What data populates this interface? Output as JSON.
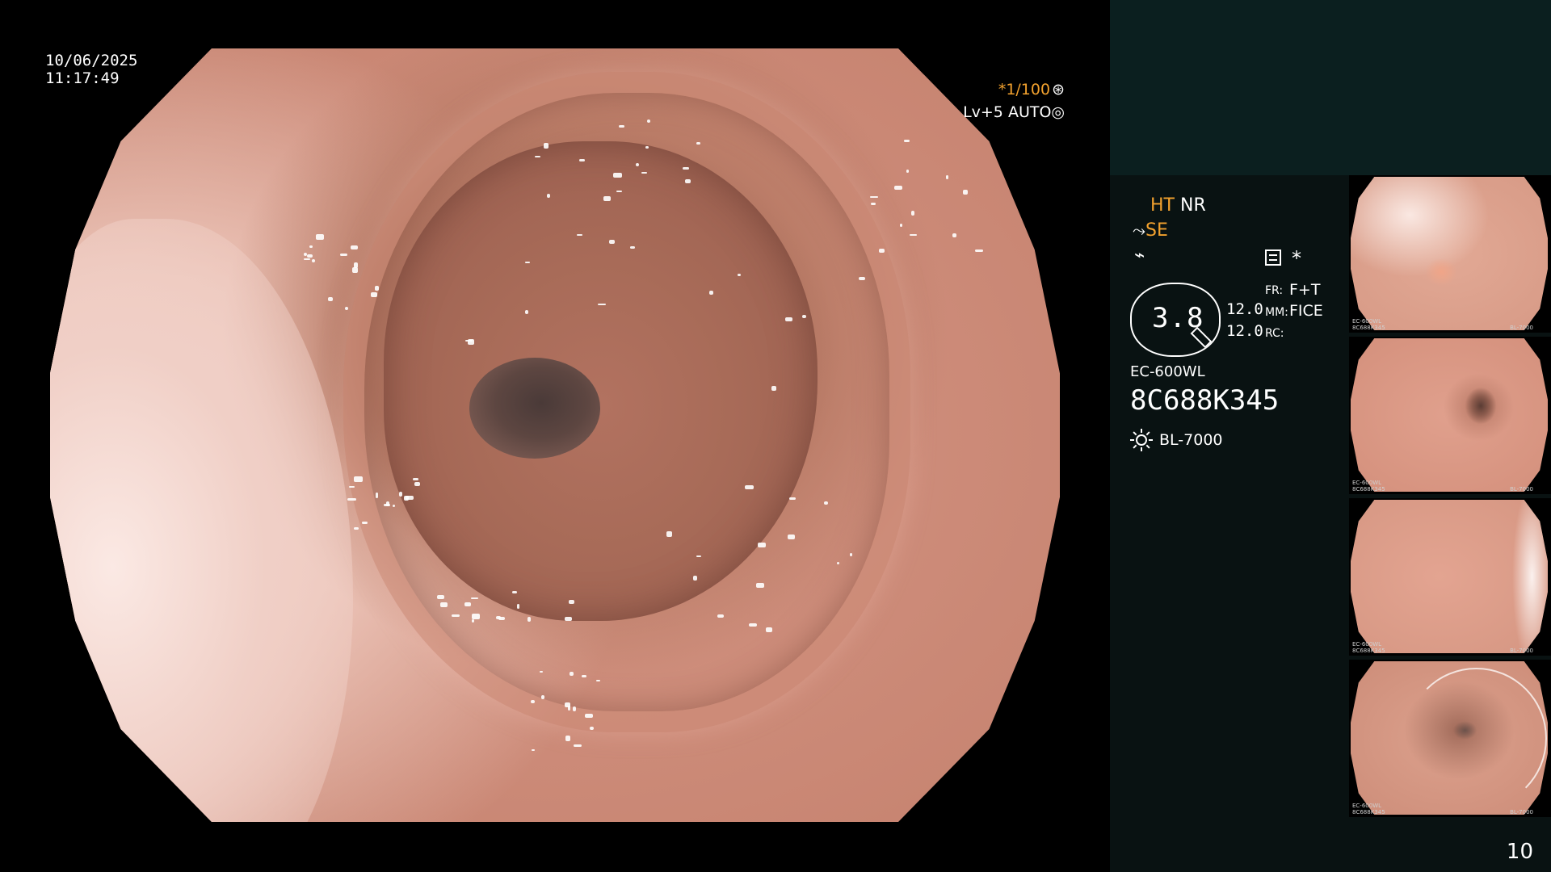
{
  "overlay": {
    "date": "10/06/2025",
    "time": "11:17:49",
    "shutter": "*1/100",
    "shutter_icon": "aperture-wheel-icon",
    "iris": "Lv+5 AUTO",
    "iris_icon": "iris-auto-icon"
  },
  "panel": {
    "enhancement_label": "HT",
    "noise_reduction": "NR",
    "structure_enhancement": "SE",
    "zoom_value": "3.8",
    "magnification_1": "12.0",
    "magnification_2": "12.0",
    "fr_label": "FR:",
    "fr_value": "F+T",
    "mm_label": "MM:",
    "mm_value": "FICE",
    "rc_label": "RC:",
    "asterisk": "*",
    "scope_model": "EC-600WL",
    "scope_serial": "8C688K345",
    "light_source": "BL-7000",
    "page_number": "10"
  },
  "thumbnails": [
    {
      "model": "EC-600WL",
      "serial": "8C688K345",
      "light": "BL-7000"
    },
    {
      "model": "EC-600WL",
      "serial": "8C688K345",
      "light": "BL-7000"
    },
    {
      "model": "EC-600WL",
      "serial": "8C688K345",
      "light": "BL-7000"
    },
    {
      "model": "EC-600WL",
      "serial": "8C688K345",
      "light": "BL-7000"
    }
  ],
  "colors": {
    "accent_orange": "#f2a12e",
    "panel_bg": "#091212",
    "panel_top_bg": "#0b1f1f"
  }
}
